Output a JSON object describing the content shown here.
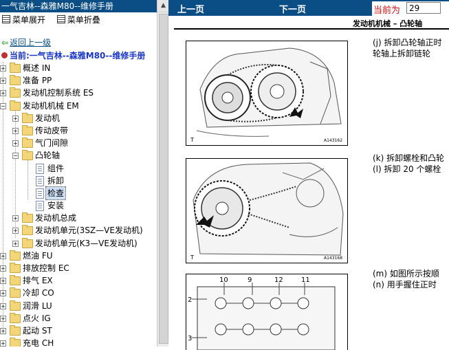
{
  "window": {
    "title": "一气吉林--森雅M80--维修手册"
  },
  "menu": {
    "expand_label": "菜单展开",
    "collapse_label": "菜单折叠"
  },
  "nav": {
    "back_label": "返回上一级",
    "current_label": "当前:一气吉林--森雅M80--维修手册"
  },
  "tree": {
    "items": [
      {
        "label": "概述  IN"
      },
      {
        "label": "准备  PP"
      },
      {
        "label": "发动机控制系统  ES"
      },
      {
        "label": "发动机机械  EM"
      },
      {
        "label": "发动机"
      },
      {
        "label": "传动皮带"
      },
      {
        "label": "气门间隙"
      },
      {
        "label": "凸轮轴"
      },
      {
        "label": "组件"
      },
      {
        "label": "拆卸"
      },
      {
        "label": "检查"
      },
      {
        "label": "安装"
      },
      {
        "label": "发动机总成"
      },
      {
        "label": "发动机单元(3SZ—VE发动机)"
      },
      {
        "label": "发动机单元(K3—VE发动机)"
      },
      {
        "label": "燃油  FU"
      },
      {
        "label": "排放控制  EC"
      },
      {
        "label": "排气  EX"
      },
      {
        "label": "冷却  CO"
      },
      {
        "label": "润滑  LU"
      },
      {
        "label": "点火  IG"
      },
      {
        "label": "起动  ST"
      },
      {
        "label": "充电  CH"
      }
    ]
  },
  "toolbar": {
    "prev_label": "上一页",
    "next_label": "下一页",
    "page_caption": "当前为",
    "page_value": "29"
  },
  "document": {
    "heading": "发动机机械  –  凸轮轴",
    "figures": [
      {
        "code": "A143162",
        "corner": "T"
      },
      {
        "code": "A143168",
        "corner": "T"
      },
      {
        "numbers": [
          "10",
          "9",
          "12",
          "11",
          "2",
          "3"
        ]
      }
    ],
    "steps": [
      {
        "text": "(j)  拆卸凸轮轴正时"
      },
      {
        "text": "     轮轴上拆卸链轮"
      },
      {
        "text": "(k)  拆卸螺栓和凸轮"
      },
      {
        "text": "(l)  拆卸 20 个螺栓"
      },
      {
        "text": "(m)  如图所示按顺"
      },
      {
        "text": "(n)  用手握住正时"
      }
    ]
  },
  "colors": {
    "titlebar": "#0b4e86",
    "current_text": "#1a36c8",
    "page_caption": "#d01010"
  }
}
